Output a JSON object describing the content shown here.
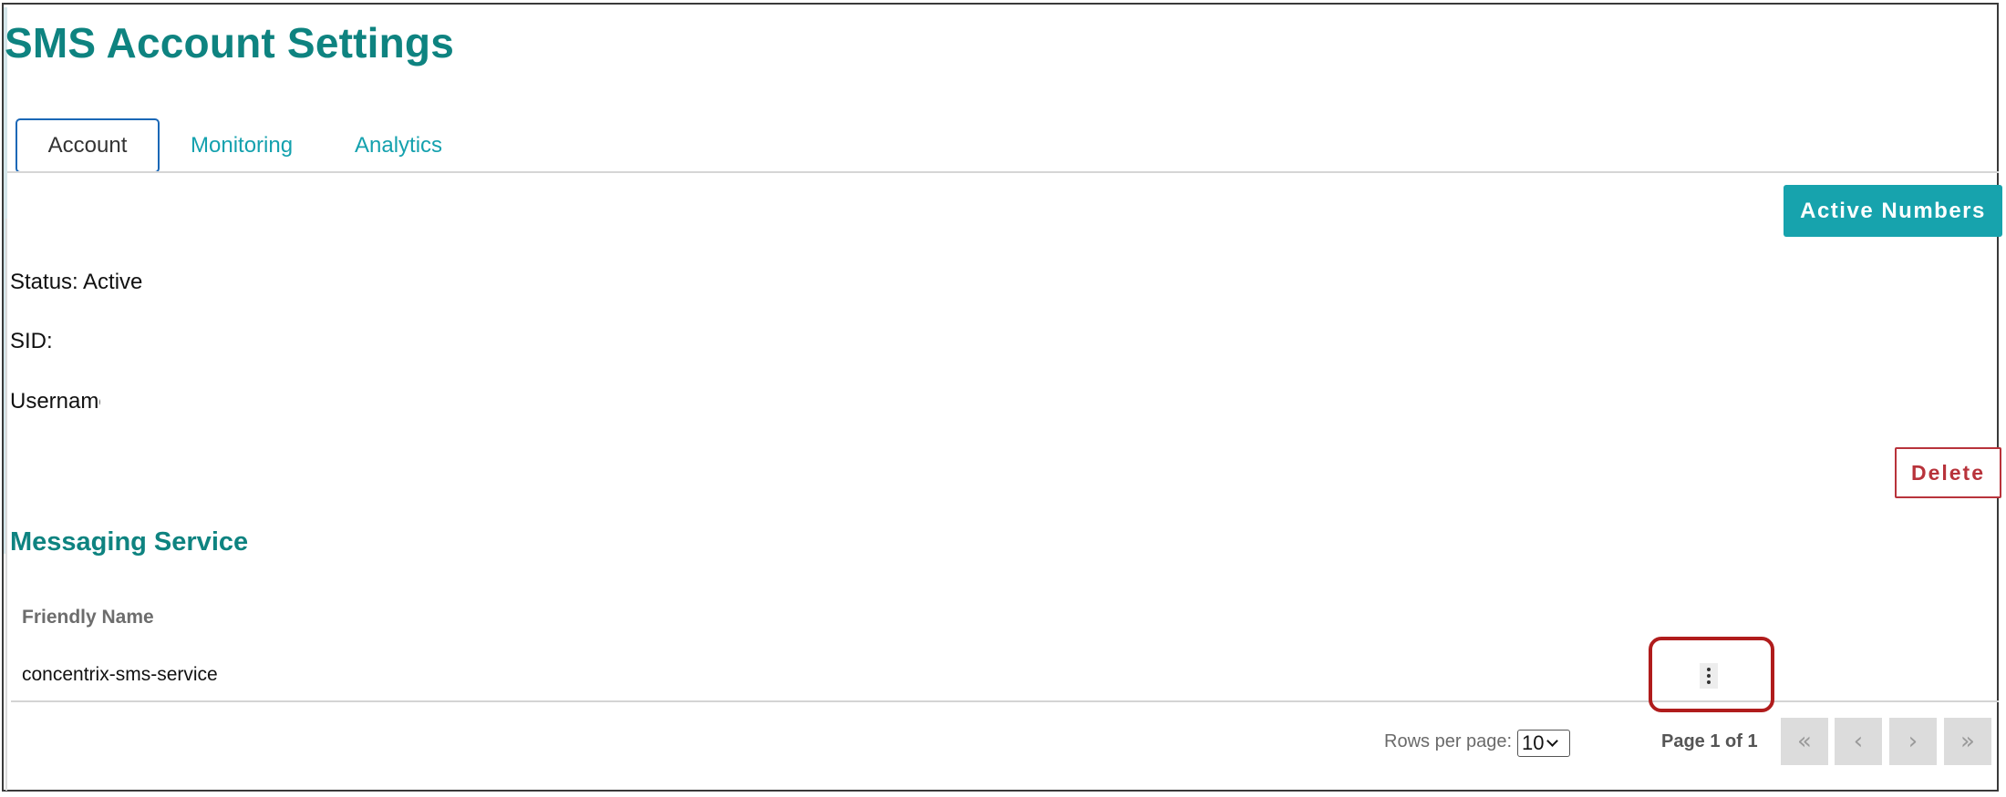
{
  "page": {
    "title": "SMS Account Settings"
  },
  "tabs": [
    {
      "label": "Account",
      "active": true
    },
    {
      "label": "Monitoring",
      "active": false
    },
    {
      "label": "Analytics",
      "active": false
    }
  ],
  "actions": {
    "active_numbers_label": "Active Numbers",
    "delete_label": "Delete"
  },
  "account_info": {
    "status": "Status: Active",
    "sid": "SID: ",
    "username": "Username"
  },
  "messaging_service": {
    "title": "Messaging Service",
    "columns": [
      "Friendly Name"
    ],
    "rows": [
      {
        "friendly_name": "concentrix-sms-service",
        "actions_icon": "more-vertical-icon"
      }
    ]
  },
  "pagination": {
    "rows_per_page_label": "Rows per page:",
    "rows_per_page_value": "10",
    "page_info": "Page 1 of 1",
    "first_icon": "«",
    "prev_icon": "‹",
    "next_icon": "›",
    "last_icon": "»"
  },
  "colors": {
    "brand_teal": "#0e8380",
    "button_teal": "#17a3ad",
    "danger": "#b8333b",
    "tab_active_border": "#1a67b6",
    "annotation_red": "#b01c1c"
  }
}
